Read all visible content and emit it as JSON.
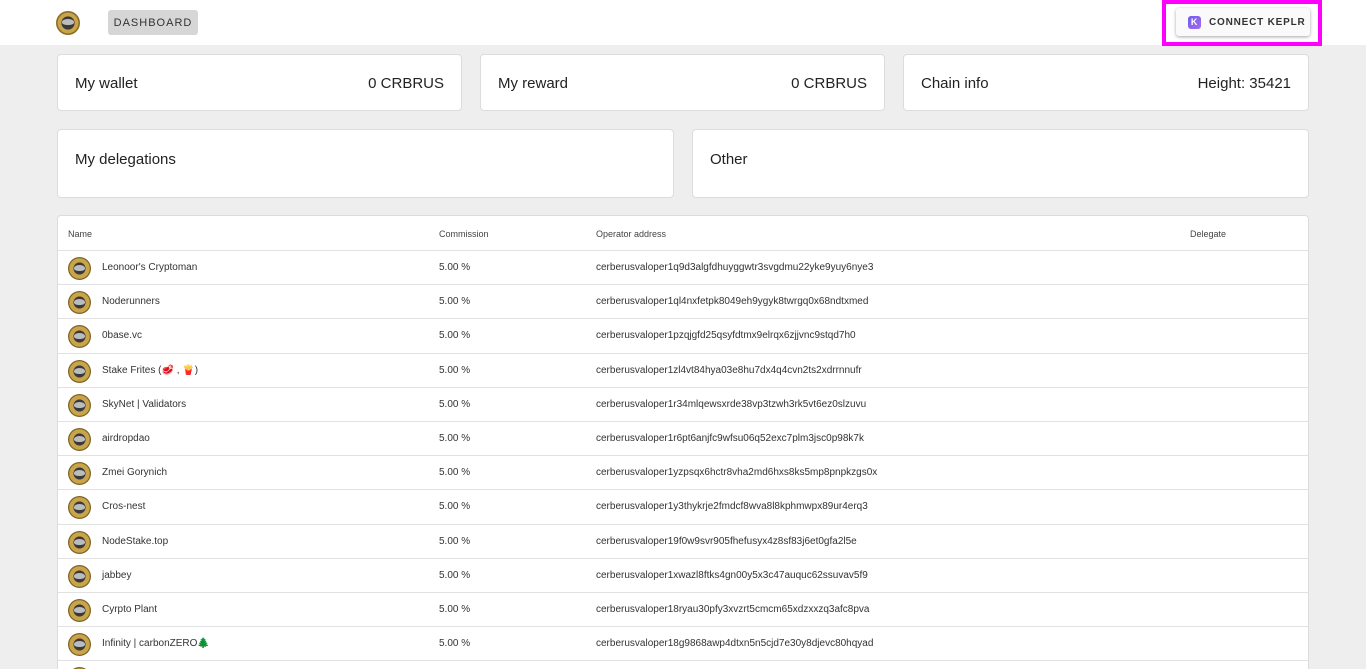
{
  "header": {
    "dashboard_label": "DASHBOARD",
    "connect_label": "CONNECT KEPLR",
    "keplr_icon_letter": "K",
    "highlight_color": "#ff00ff"
  },
  "cards": {
    "wallet": {
      "title": "My wallet",
      "value": "0 CRBRUS"
    },
    "reward": {
      "title": "My reward",
      "value": "0 CRBRUS"
    },
    "chain": {
      "title": "Chain info",
      "value": "Height: 35421"
    },
    "delegations": {
      "title": "My delegations"
    },
    "other": {
      "title": "Other"
    }
  },
  "table": {
    "columns": {
      "name": "Name",
      "commission": "Commission",
      "operator": "Operator address",
      "delegate": "Delegate"
    },
    "rows": [
      {
        "name": "Leonoor's Cryptoman",
        "commission": "5.00 %",
        "address": "cerberusvaloper1q9d3algfdhuyggwtr3svgdmu22yke9yuy6nye3"
      },
      {
        "name": "Noderunners",
        "commission": "5.00 %",
        "address": "cerberusvaloper1ql4nxfetpk8049eh9ygyk8twrgq0x68ndtxmed"
      },
      {
        "name": "0base.vc",
        "commission": "5.00 %",
        "address": "cerberusvaloper1pzqjgfd25qsyfdtmx9elrqx6zjjvnc9stqd7h0"
      },
      {
        "name": "Stake Frites (🥩 , 🍟)",
        "commission": "5.00 %",
        "address": "cerberusvaloper1zl4vt84hya03e8hu7dx4q4cvn2ts2xdrrnnufr"
      },
      {
        "name": "SkyNet | Validators",
        "commission": "5.00 %",
        "address": "cerberusvaloper1r34mlqewsxrde38vp3tzwh3rk5vt6ez0slzuvu"
      },
      {
        "name": "airdropdao",
        "commission": "5.00 %",
        "address": "cerberusvaloper1r6pt6anjfc9wfsu06q52exc7plm3jsc0p98k7k"
      },
      {
        "name": "Zmei Gorynich",
        "commission": "5.00 %",
        "address": "cerberusvaloper1yzpsqx6hctr8vha2md6hxs8ks5mp8pnpkzgs0x"
      },
      {
        "name": "Cros-nest",
        "commission": "5.00 %",
        "address": "cerberusvaloper1y3thykrje2fmdcf8wva8l8kphmwpx89ur4erq3"
      },
      {
        "name": "NodeStake.top",
        "commission": "5.00 %",
        "address": "cerberusvaloper19f0w9svr905fhefusyx4z8sf83j6et0gfa2l5e"
      },
      {
        "name": "jabbey",
        "commission": "5.00 %",
        "address": "cerberusvaloper1xwazl8ftks4gn00y5x3c47auquc62ssuvav5f9"
      },
      {
        "name": "Cyrpto Plant",
        "commission": "5.00 %",
        "address": "cerberusvaloper18ryau30pfy3xvzrt5cmcm65xdzxxzq3afc8pva"
      },
      {
        "name": "Infinity | carbonZERO🌲",
        "commission": "5.00 %",
        "address": "cerberusvaloper18g9868awp4dtxn5n5cjd7e30y8djevc80hqyad"
      },
      {
        "name": "",
        "commission": "",
        "address": ""
      }
    ]
  }
}
